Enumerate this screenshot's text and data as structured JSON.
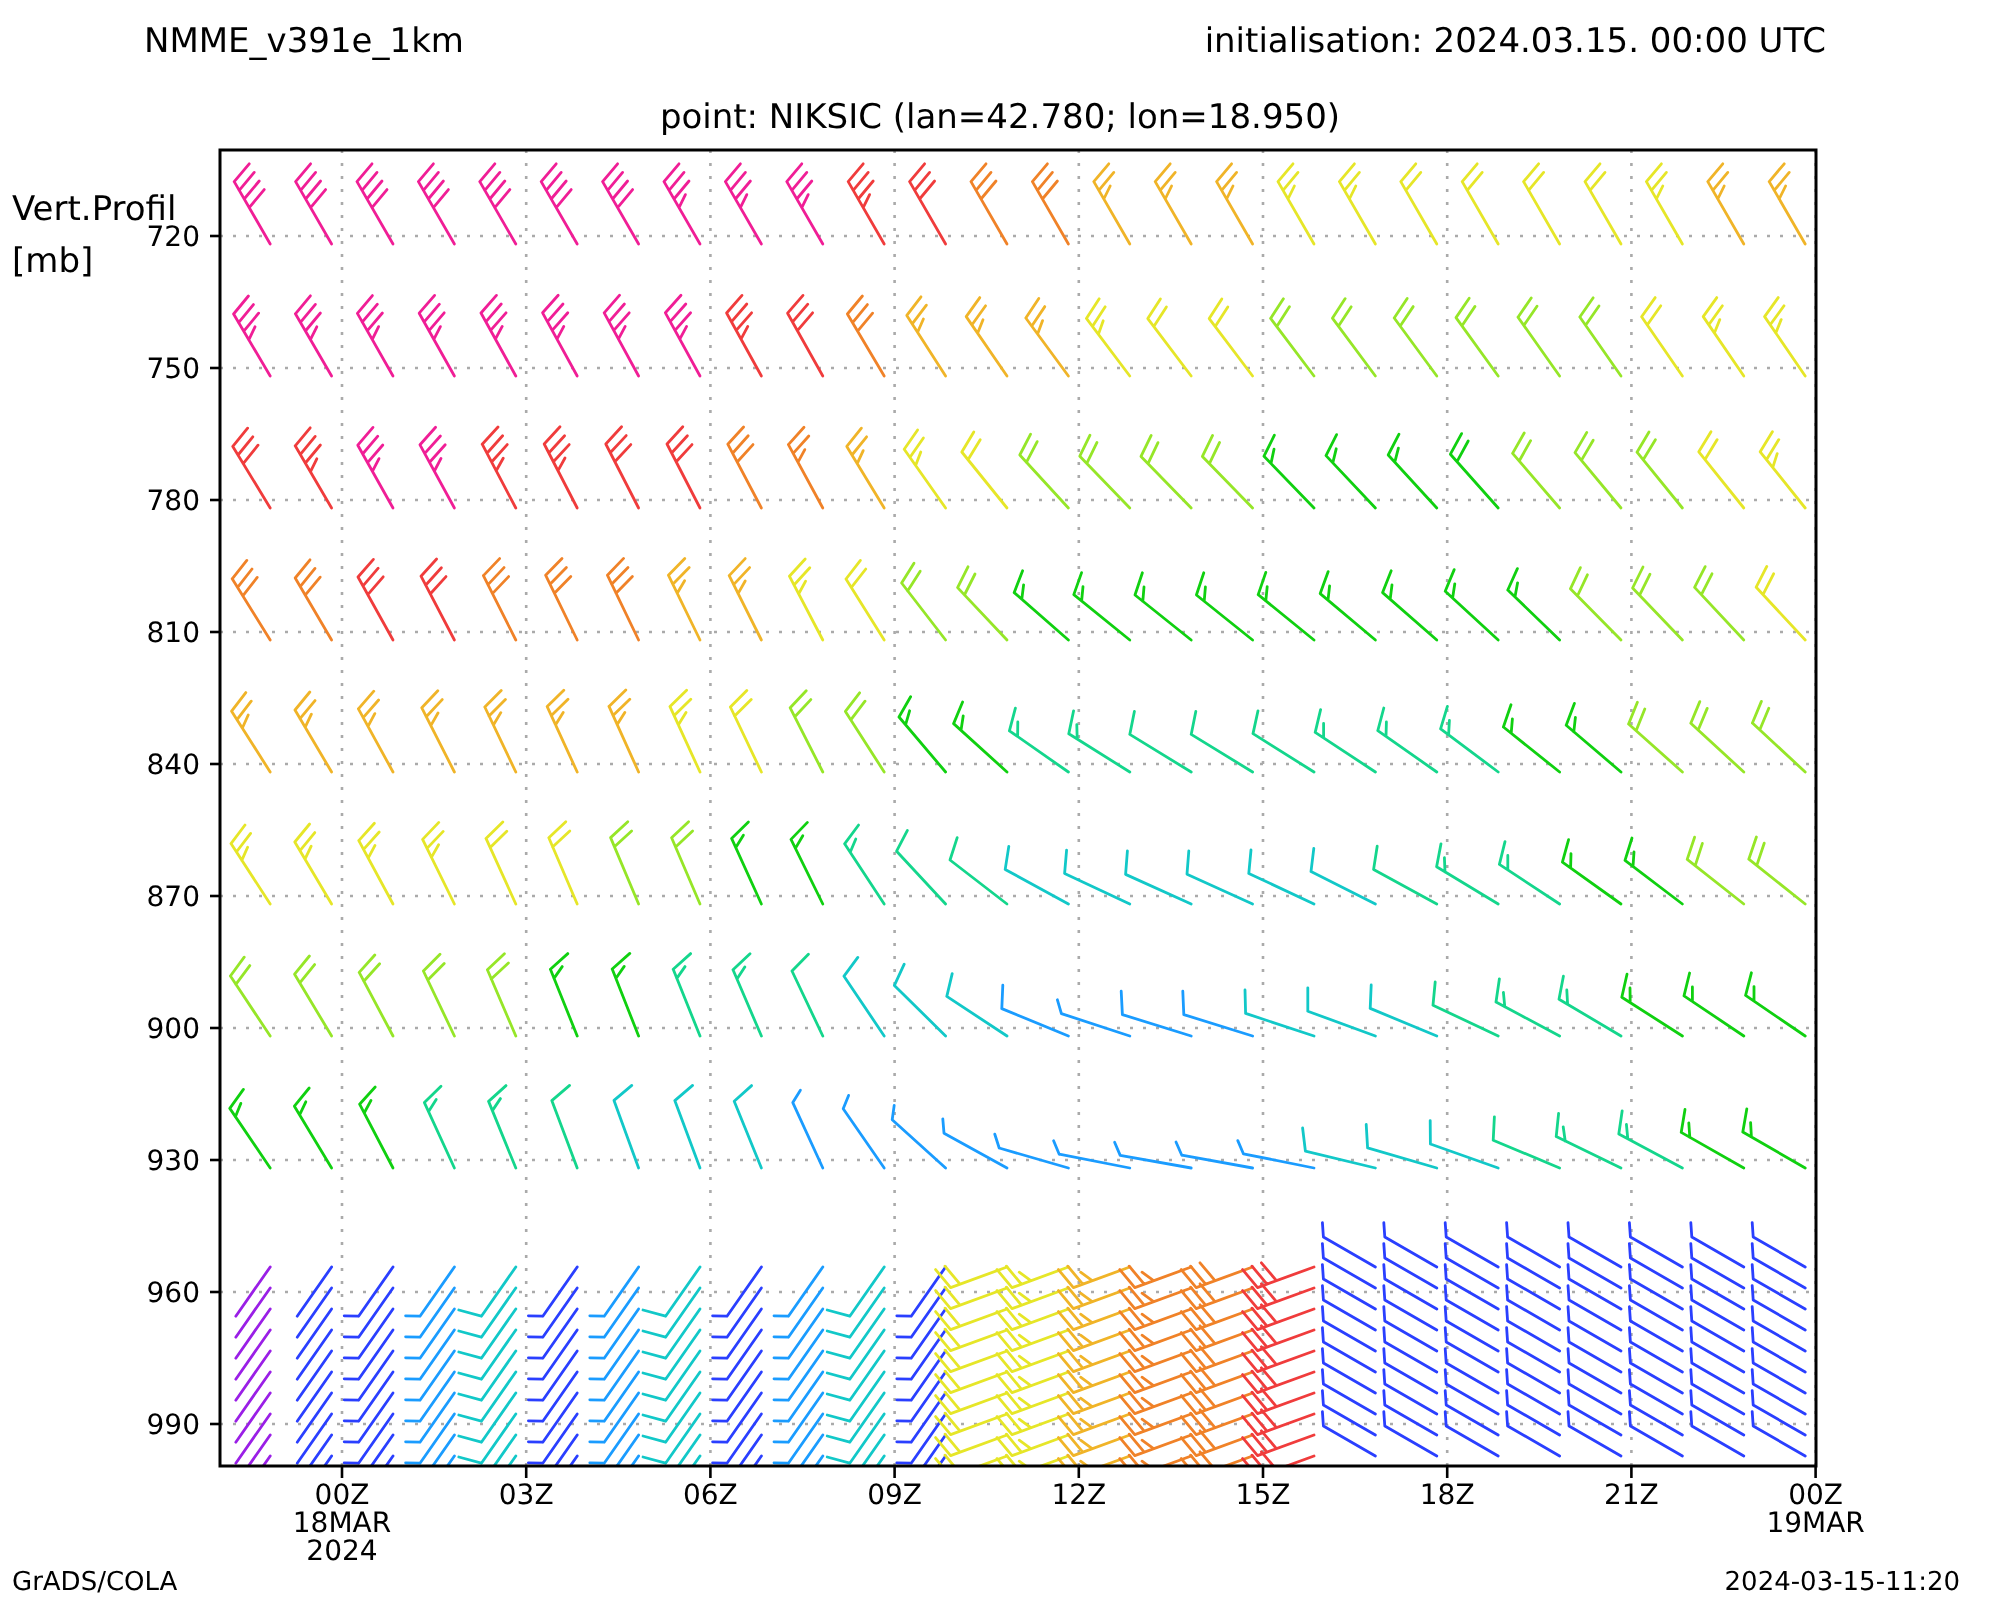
{
  "header": {
    "model": "NMME_v391e_1km",
    "initialisation": "initialisation: 2024.03.15. 00:00 UTC",
    "point": "point: NIKSIC (lan=42.780; lon=18.950)"
  },
  "y_axis": {
    "label": [
      "Vert.Profil",
      "[mb]"
    ],
    "ticks": [
      "720",
      "750",
      "780",
      "810",
      "840",
      "870",
      "900",
      "930",
      "960",
      "990"
    ]
  },
  "x_axis": {
    "ticks": [
      [
        "00Z",
        "18MAR",
        "2024"
      ],
      [
        "03Z"
      ],
      [
        "06Z"
      ],
      [
        "09Z"
      ],
      [
        "12Z"
      ],
      [
        "15Z"
      ],
      [
        "18Z"
      ],
      [
        "21Z"
      ],
      [
        "00Z",
        "19MAR"
      ]
    ]
  },
  "footer": {
    "left": "GrADS/COLA",
    "right": "2024-03-15-11:20"
  }
}
